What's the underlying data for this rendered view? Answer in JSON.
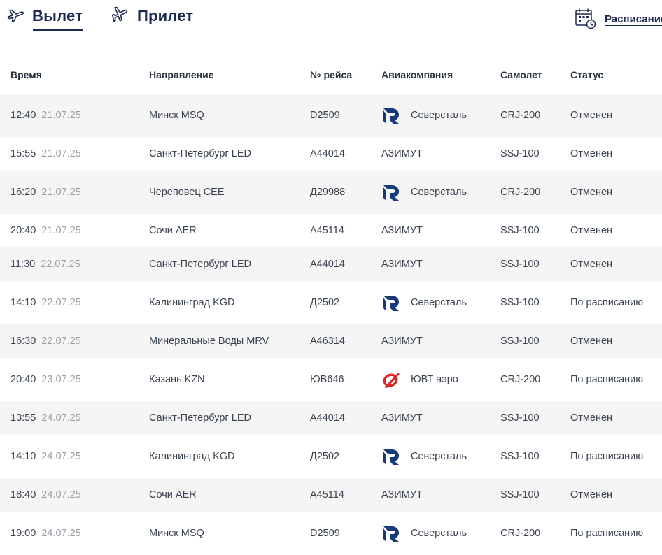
{
  "tabs": {
    "departure": "Вылет",
    "arrival": "Прилет",
    "schedule": "Расписание"
  },
  "columns": [
    "Время",
    "Направление",
    "№ рейса",
    "Авиакомпания",
    "Самолет",
    "Статус"
  ],
  "rows": [
    {
      "time": "12:40",
      "date": "21.07.25",
      "direction": "Минск MSQ",
      "flight": "D2509",
      "airline": "Северсталь",
      "logo": "severstal-logo-icon",
      "plane": "CRJ-200",
      "status": "Отменен"
    },
    {
      "time": "15:55",
      "date": "21.07.25",
      "direction": "Санкт-Петербург LED",
      "flight": "А44014",
      "airline": "АЗИМУТ",
      "logo": "",
      "plane": "SSJ-100",
      "status": "Отменен"
    },
    {
      "time": "16:20",
      "date": "21.07.25",
      "direction": "Череповец CEE",
      "flight": "Д29988",
      "airline": "Северсталь",
      "logo": "severstal-logo-icon",
      "plane": "CRJ-200",
      "status": "Отменен"
    },
    {
      "time": "20:40",
      "date": "21.07.25",
      "direction": "Сочи AER",
      "flight": "А45114",
      "airline": "АЗИМУТ",
      "logo": "",
      "plane": "SSJ-100",
      "status": "Отменен"
    },
    {
      "time": "11:30",
      "date": "22.07.25",
      "direction": "Санкт-Петербург LED",
      "flight": "А44014",
      "airline": "АЗИМУТ",
      "logo": "",
      "plane": "SSJ-100",
      "status": "Отменен"
    },
    {
      "time": "14:10",
      "date": "22.07.25",
      "direction": "Калининград KGD",
      "flight": "Д2502",
      "airline": "Северсталь",
      "logo": "severstal-logo-icon",
      "plane": "SSJ-100",
      "status": "По расписанию"
    },
    {
      "time": "16:30",
      "date": "22.07.25",
      "direction": "Минеральные Воды MRV",
      "flight": "А46314",
      "airline": "АЗИМУТ",
      "logo": "",
      "plane": "SSJ-100",
      "status": "Отменен"
    },
    {
      "time": "20:40",
      "date": "23.07.25",
      "direction": "Казань KZN",
      "flight": "ЮВ646",
      "airline": "ЮВТ аэро",
      "logo": "uvt-aero-logo-icon",
      "plane": "CRJ-200",
      "status": "По расписанию"
    },
    {
      "time": "13:55",
      "date": "24.07.25",
      "direction": "Санкт-Петербург LED",
      "flight": "А44014",
      "airline": "АЗИМУТ",
      "logo": "",
      "plane": "SSJ-100",
      "status": "Отменен"
    },
    {
      "time": "14:10",
      "date": "24.07.25",
      "direction": "Калининград KGD",
      "flight": "Д2502",
      "airline": "Северсталь",
      "logo": "severstal-logo-icon",
      "plane": "SSJ-100",
      "status": "По расписанию"
    },
    {
      "time": "18:40",
      "date": "24.07.25",
      "direction": "Сочи AER",
      "flight": "А45114",
      "airline": "АЗИМУТ",
      "logo": "",
      "plane": "SSJ-100",
      "status": "Отменен"
    },
    {
      "time": "19:00",
      "date": "24.07.25",
      "direction": "Минск MSQ",
      "flight": "D2509",
      "airline": "Северсталь",
      "logo": "severstal-logo-icon",
      "plane": "CRJ-200",
      "status": "По расписанию"
    }
  ],
  "colors": {
    "brand_navy": "#1d2a4f",
    "row_shade": "#f5f5f5",
    "severstal_blue": "#173a78",
    "uvt_red": "#d8262b"
  },
  "icons": {
    "departure": "plane-takeoff-icon",
    "arrival": "plane-landing-icon",
    "schedule": "calendar-clock-icon"
  }
}
